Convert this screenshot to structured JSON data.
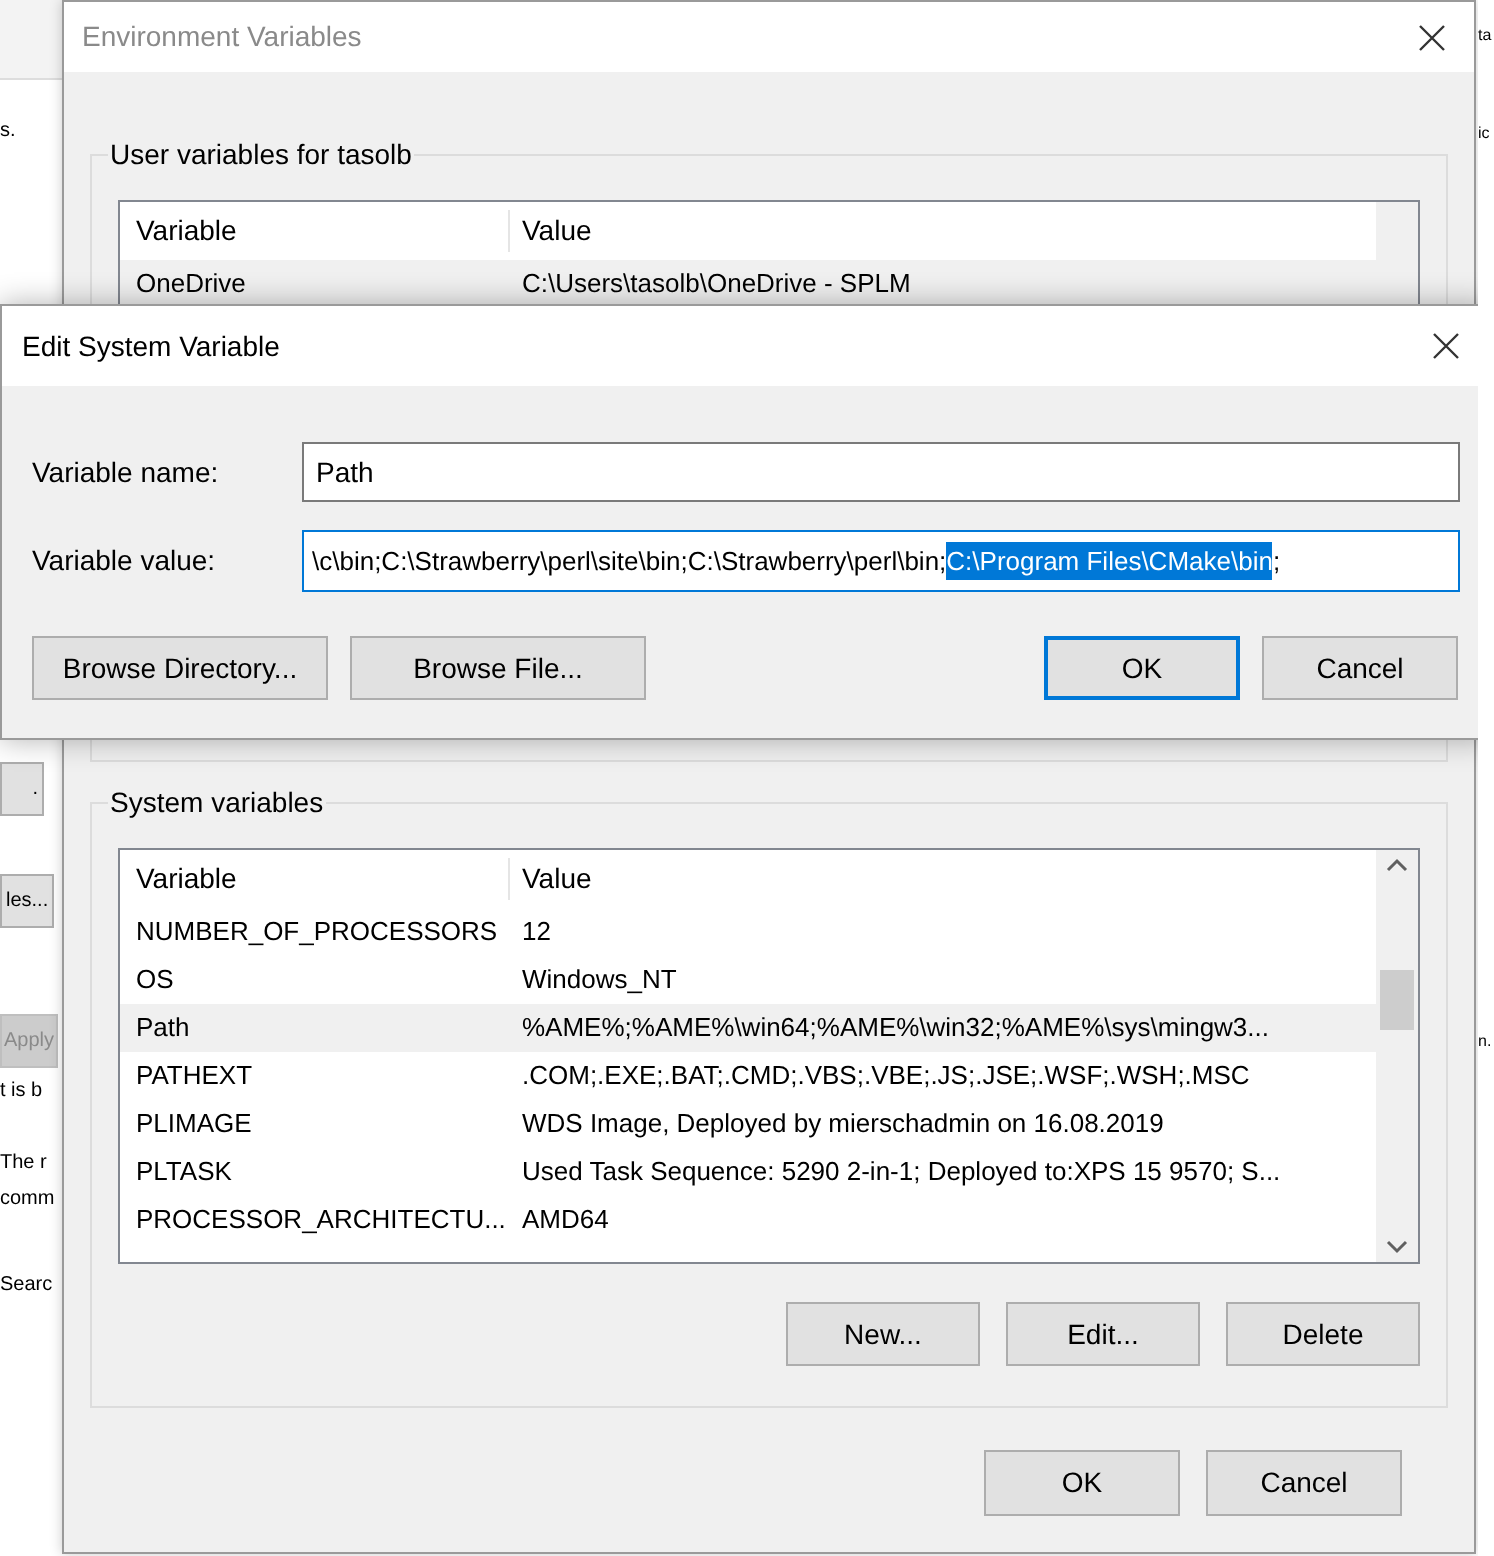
{
  "background": {
    "left_texts": [
      {
        "kind": "text",
        "text": "s."
      },
      {
        "kind": "button",
        "text": "."
      },
      {
        "kind": "button",
        "text": "les..."
      },
      {
        "kind": "disabled-button",
        "text": "Apply"
      },
      {
        "kind": "text",
        "text": "t is b"
      },
      {
        "kind": "text",
        "text": "The r"
      },
      {
        "kind": "text",
        "text": "comm"
      },
      {
        "kind": "text",
        "text": "Searc"
      }
    ],
    "right_texts": [
      "ta",
      "ic",
      "n."
    ]
  },
  "environment_window": {
    "title": "Environment Variables",
    "user_variables": {
      "label": "User variables for tasolb",
      "columns": [
        "Variable",
        "Value"
      ],
      "rows": [
        {
          "variable": "OneDrive",
          "value": "C:\\Users\\tasolb\\OneDrive - SPLM",
          "selected": true
        }
      ]
    },
    "system_variables": {
      "label": "System variables",
      "columns": [
        "Variable",
        "Value"
      ],
      "rows": [
        {
          "variable": "NUMBER_OF_PROCESSORS",
          "value": "12",
          "selected": false
        },
        {
          "variable": "OS",
          "value": "Windows_NT",
          "selected": false
        },
        {
          "variable": "Path",
          "value": "%AME%;%AME%\\win64;%AME%\\win32;%AME%\\sys\\mingw3...",
          "selected": true
        },
        {
          "variable": "PATHEXT",
          "value": ".COM;.EXE;.BAT;.CMD;.VBS;.VBE;.JS;.JSE;.WSF;.WSH;.MSC",
          "selected": false
        },
        {
          "variable": "PLIMAGE",
          "value": "WDS Image, Deployed by mierschadmin on 16.08.2019",
          "selected": false
        },
        {
          "variable": "PLTASK",
          "value": "Used Task Sequence: 5290 2-in-1; Deployed to:XPS 15 9570; S...",
          "selected": false
        },
        {
          "variable": "PROCESSOR_ARCHITECTU...",
          "value": "AMD64",
          "selected": false
        }
      ],
      "buttons": [
        "New...",
        "Edit...",
        "Delete"
      ]
    },
    "buttons": [
      "OK",
      "Cancel"
    ]
  },
  "edit_dialog": {
    "title": "Edit System Variable",
    "name_label": "Variable name:",
    "name_value": "Path",
    "value_label": "Variable value:",
    "value_parts": [
      {
        "text": "\\c\\bin;C:\\Strawberry\\perl\\site\\bin;C:\\Strawberry\\perl\\bin;",
        "selected": false
      },
      {
        "text": "C:\\Program Files\\CMake\\bin",
        "selected": true
      },
      {
        "text": ";",
        "selected": false
      }
    ],
    "left_buttons": [
      "Browse Directory...",
      "Browse File..."
    ],
    "right_buttons": [
      {
        "label": "OK",
        "default": true
      },
      {
        "label": "Cancel",
        "default": false
      }
    ]
  }
}
